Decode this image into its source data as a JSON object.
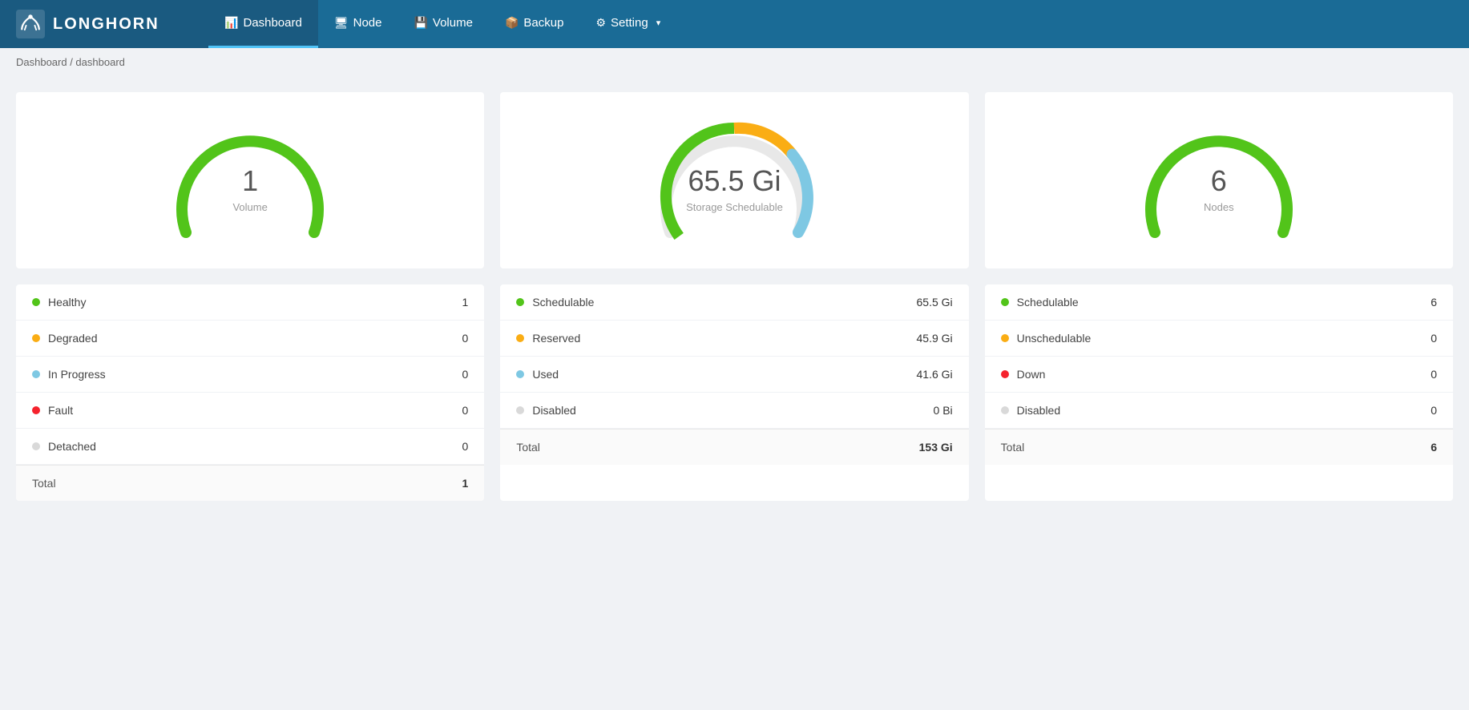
{
  "header": {
    "logo_text": "LONGHORN",
    "nav": [
      {
        "id": "dashboard",
        "label": "Dashboard",
        "icon": "📊",
        "active": true
      },
      {
        "id": "node",
        "label": "Node",
        "icon": "🖥"
      },
      {
        "id": "volume",
        "label": "Volume",
        "icon": "💾"
      },
      {
        "id": "backup",
        "label": "Backup",
        "icon": "📦"
      },
      {
        "id": "setting",
        "label": "Setting",
        "icon": "⚙"
      }
    ]
  },
  "breadcrumb": "Dashboard / dashboard",
  "gauges": [
    {
      "id": "volume-gauge",
      "value": "1",
      "label": "Volume",
      "type": "simple",
      "color": "#52c41a"
    },
    {
      "id": "storage-gauge",
      "value": "65.5 Gi",
      "label": "Storage Schedulable",
      "type": "multi",
      "segments": [
        {
          "color": "#52c41a",
          "pct": 42
        },
        {
          "color": "#faad14",
          "pct": 30
        },
        {
          "color": "#7ec8e3",
          "pct": 27
        }
      ]
    },
    {
      "id": "nodes-gauge",
      "value": "6",
      "label": "Nodes",
      "type": "simple",
      "color": "#52c41a"
    }
  ],
  "stats": [
    {
      "id": "volume-stats",
      "items": [
        {
          "label": "Healthy",
          "dot": "green",
          "value": "1"
        },
        {
          "label": "Degraded",
          "dot": "yellow",
          "value": "0"
        },
        {
          "label": "In Progress",
          "dot": "blue",
          "value": "0"
        },
        {
          "label": "Fault",
          "dot": "red",
          "value": "0"
        },
        {
          "label": "Detached",
          "dot": "gray",
          "value": "0"
        }
      ],
      "total_label": "Total",
      "total_value": "1"
    },
    {
      "id": "storage-stats",
      "items": [
        {
          "label": "Schedulable",
          "dot": "green",
          "value": "65.5 Gi"
        },
        {
          "label": "Reserved",
          "dot": "yellow",
          "value": "45.9 Gi"
        },
        {
          "label": "Used",
          "dot": "blue",
          "value": "41.6 Gi"
        },
        {
          "label": "Disabled",
          "dot": "gray",
          "value": "0 Bi"
        }
      ],
      "total_label": "Total",
      "total_value": "153 Gi"
    },
    {
      "id": "nodes-stats",
      "items": [
        {
          "label": "Schedulable",
          "dot": "green",
          "value": "6"
        },
        {
          "label": "Unschedulable",
          "dot": "yellow",
          "value": "0"
        },
        {
          "label": "Down",
          "dot": "red",
          "value": "0"
        },
        {
          "label": "Disabled",
          "dot": "gray",
          "value": "0"
        }
      ],
      "total_label": "Total",
      "total_value": "6"
    }
  ]
}
